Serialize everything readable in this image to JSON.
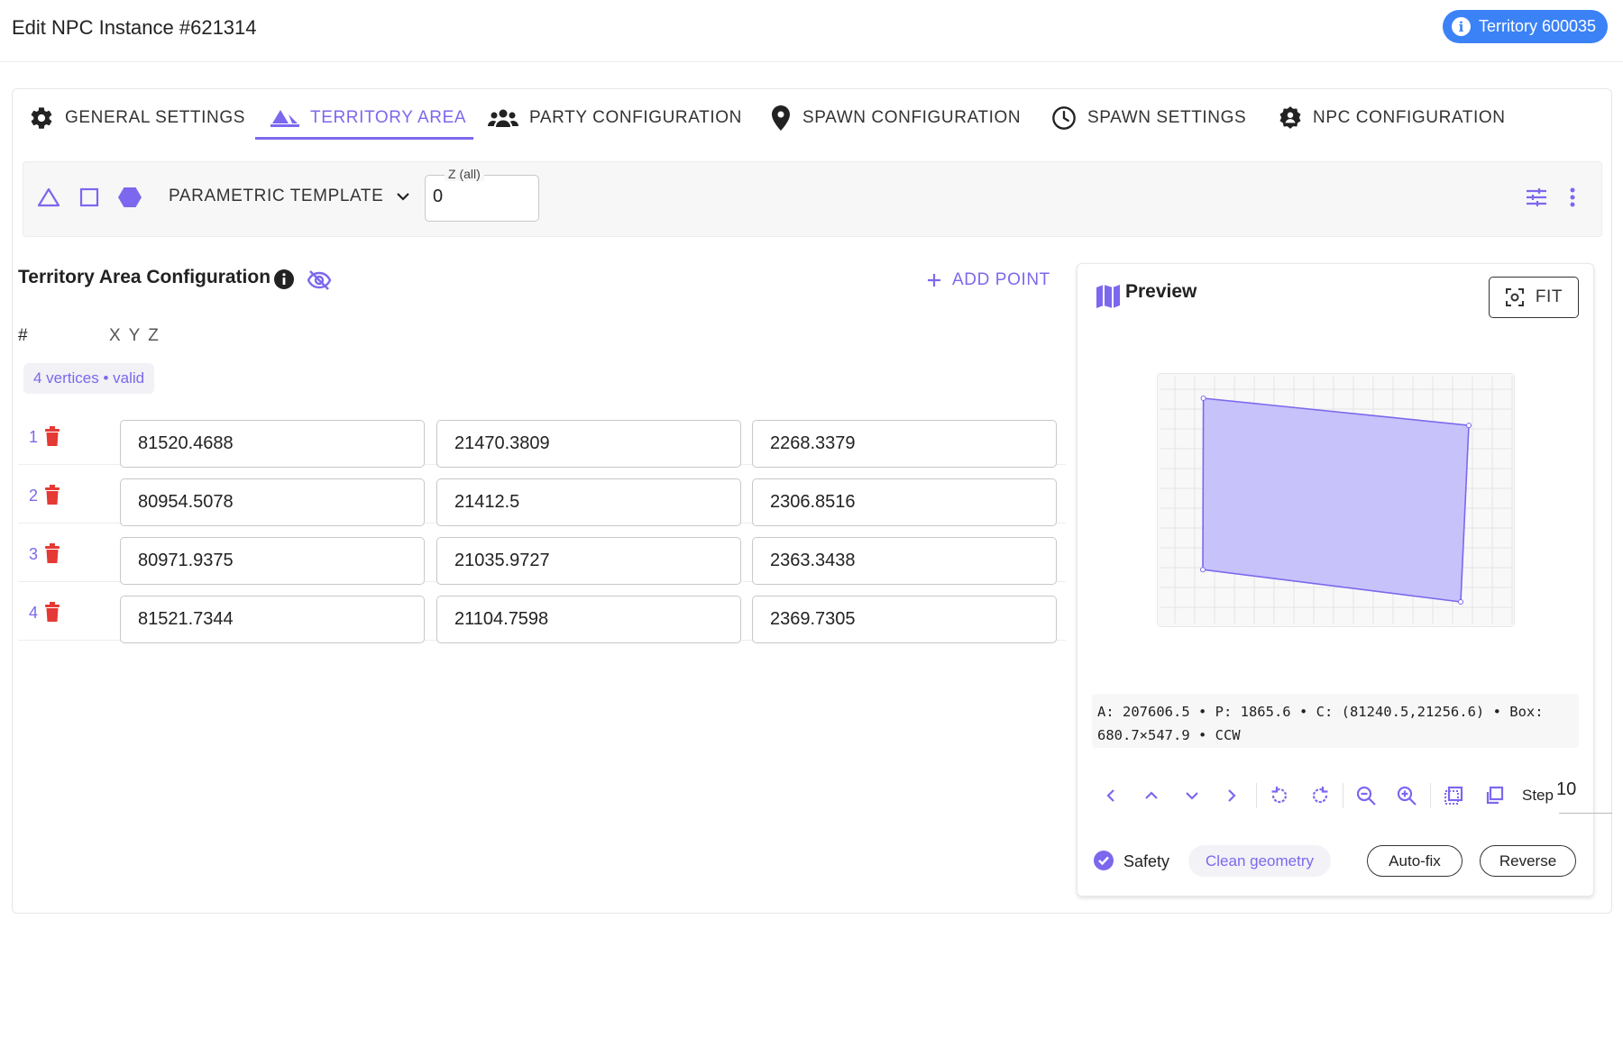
{
  "header": {
    "title": "Edit NPC Instance #621314",
    "territory_chip": "Territory 600035"
  },
  "tabs": [
    {
      "label": "GENERAL SETTINGS",
      "icon": "gear-icon"
    },
    {
      "label": "TERRITORY AREA",
      "icon": "mountain-icon",
      "active": true
    },
    {
      "label": "PARTY CONFIGURATION",
      "icon": "group-icon"
    },
    {
      "label": "SPAWN CONFIGURATION",
      "icon": "location-pin-icon"
    },
    {
      "label": "SPAWN SETTINGS",
      "icon": "clock-icon"
    },
    {
      "label": "NPC CONFIGURATION",
      "icon": "npc-badge-icon"
    }
  ],
  "toolbar": {
    "shape_tools": [
      "triangle-icon",
      "square-icon",
      "hexagon-icon"
    ],
    "template_label": "PARAMETRIC TEMPLATE",
    "z_label": "Z (all)",
    "z_value": "0"
  },
  "territory": {
    "title": "Territory Area Configuration",
    "add_point_label": "ADD POINT",
    "col_index": "#",
    "col_coords": "X Y Z",
    "status": "4 vertices • valid",
    "vertices": [
      {
        "index": "1",
        "x": "81520.4688",
        "y": "21470.3809",
        "z": "2268.3379"
      },
      {
        "index": "2",
        "x": "80954.5078",
        "y": "21412.5",
        "z": "2306.8516"
      },
      {
        "index": "3",
        "x": "80971.9375",
        "y": "21035.9727",
        "z": "2363.3438"
      },
      {
        "index": "4",
        "x": "81521.7344",
        "y": "21104.7598",
        "z": "2369.7305"
      }
    ]
  },
  "preview": {
    "title": "Preview",
    "fit_label": "FIT",
    "stats_line1": "A: 207606.5 • P: 1865.6 • C: (81240.5,21256.6) • Box:",
    "stats_line2": "680.7×547.9 • CCW",
    "step_label": "Step",
    "step_value": "10",
    "safety_label": "Safety",
    "safety_checked": true,
    "clean_label": "Clean geometry",
    "autofix_label": "Auto-fix",
    "reverse_label": "Reverse"
  },
  "colors": {
    "accent": "#7b68ee",
    "chip": "#3b82f6",
    "delete": "#e53935",
    "polygon_fill": "#c4bffa"
  }
}
